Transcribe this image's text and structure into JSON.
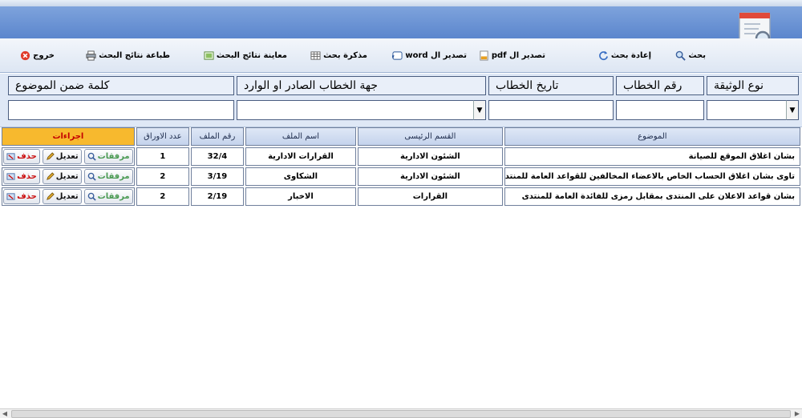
{
  "toolbar": {
    "search": "بحث",
    "reset": "إعادة بحث",
    "export_pdf": "تصدير ال pdf",
    "export_word": "تصدير ال word",
    "search_memo": "مذكرة بحث",
    "preview_results": "معاينة نتائج البحث",
    "print_results": "طباعة نتائج البحث",
    "exit": "خروج"
  },
  "search_form": {
    "doc_type": "نوع الوثيقة",
    "letter_number": "رقم الخطاب",
    "letter_date": "تاريخ الخطاب",
    "sender_receiver": "جهة الخطاب الصادر او الوارد",
    "keyword": "كلمة ضمن الموضوع",
    "doc_type_value": "",
    "letter_number_value": "",
    "letter_date_value": "",
    "sender_receiver_value": "",
    "keyword_value": ""
  },
  "table": {
    "headers": {
      "subject": "الموضوع",
      "main_section": "القسم الرئيسى",
      "file_name": "اسم الملف",
      "file_number": "رقم الملف",
      "pages_count": "عدد الاوراق",
      "actions": "اجراءات"
    },
    "rows": [
      {
        "subject": "بشان اغلاق الموقع للصيانة",
        "main_section": "الشئون الادارية",
        "file_name": "القرارات الادارية",
        "file_number": "32/4",
        "pages_count": "1"
      },
      {
        "subject": "تاوى بشان اغلاق الحساب الخاص بالاعضاء المخالفين للقواعد العامة للمنتد",
        "main_section": "الشئون الادارية",
        "file_name": "الشكاوى",
        "file_number": "3/19",
        "pages_count": "2"
      },
      {
        "subject": "بشان قواعد الاعلان على المنتدى بمقابل رمزى للفائدة العامة للمنتدى",
        "main_section": "القرارات",
        "file_name": "الاخبار",
        "file_number": "2/19",
        "pages_count": "2"
      }
    ],
    "action_labels": {
      "attachments": "مرفقات",
      "edit": "تعديل",
      "delete": "حذف"
    }
  },
  "colors": {
    "header_blue": "#6b93d6",
    "actions_header": "#f7b92e",
    "delete_red": "#cc1010",
    "attach_green": "#4a9a52"
  }
}
